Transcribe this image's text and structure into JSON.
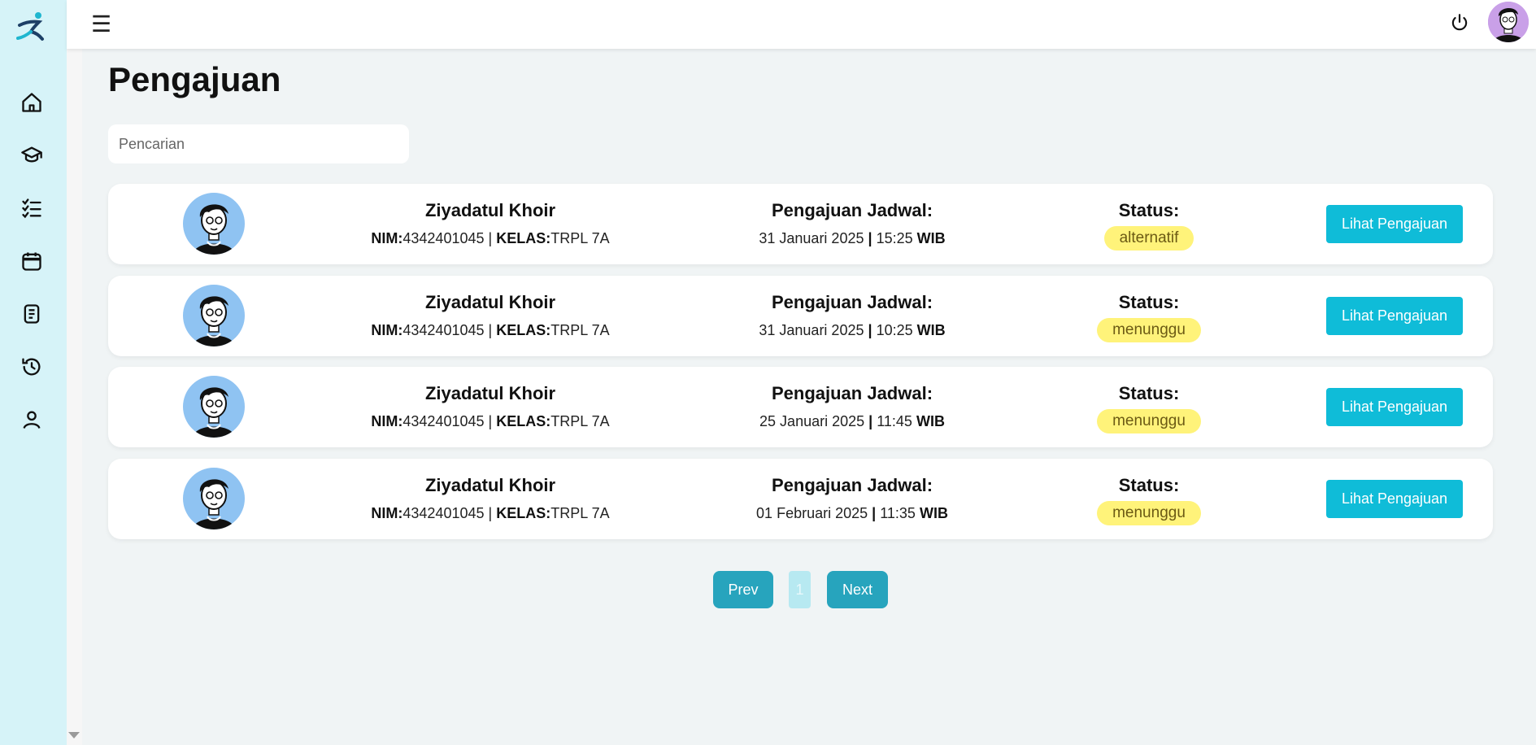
{
  "sidebar": {
    "logo": "runner-logo",
    "items": [
      {
        "icon": "home-icon"
      },
      {
        "icon": "graduation-cap-icon"
      },
      {
        "icon": "checklist-icon"
      },
      {
        "icon": "calendar-icon"
      },
      {
        "icon": "document-icon"
      },
      {
        "icon": "history-icon"
      },
      {
        "icon": "user-icon"
      }
    ]
  },
  "topbar": {
    "menu_glyph": "☰",
    "power_icon": "power-icon",
    "avatar_icon": "user-avatar-icon"
  },
  "page": {
    "title": "Pengajuan"
  },
  "search": {
    "placeholder": "Pencarian",
    "value": ""
  },
  "labels": {
    "nim": "NIM:",
    "kelas": "KELAS:",
    "separator": "|",
    "schedule_title": "Pengajuan Jadwal:",
    "status_title": "Status:",
    "timezone": "WIB",
    "view_button": "Lihat Pengajuan"
  },
  "submissions": [
    {
      "name": "Ziyadatul Khoir",
      "nim": "4342401045",
      "kelas": "TRPL 7A",
      "date": "31 Januari 2025",
      "time": "15:25",
      "status": "alternatif"
    },
    {
      "name": "Ziyadatul Khoir",
      "nim": "4342401045",
      "kelas": "TRPL 7A",
      "date": "31 Januari 2025",
      "time": "10:25",
      "status": "menunggu"
    },
    {
      "name": "Ziyadatul Khoir",
      "nim": "4342401045",
      "kelas": "TRPL 7A",
      "date": "25 Januari 2025",
      "time": "11:45",
      "status": "menunggu"
    },
    {
      "name": "Ziyadatul Khoir",
      "nim": "4342401045",
      "kelas": "TRPL 7A",
      "date": "01 Februari 2025",
      "time": "11:35",
      "status": "menunggu"
    }
  ],
  "pagination": {
    "prev": "Prev",
    "current": "1",
    "next": "Next"
  },
  "colors": {
    "sidebar_bg": "#d6f3f8",
    "accent": "#0fbcd8",
    "pager": "#27a4bd",
    "badge_bg": "#fff37a",
    "page_bg": "#f0f4f5"
  }
}
